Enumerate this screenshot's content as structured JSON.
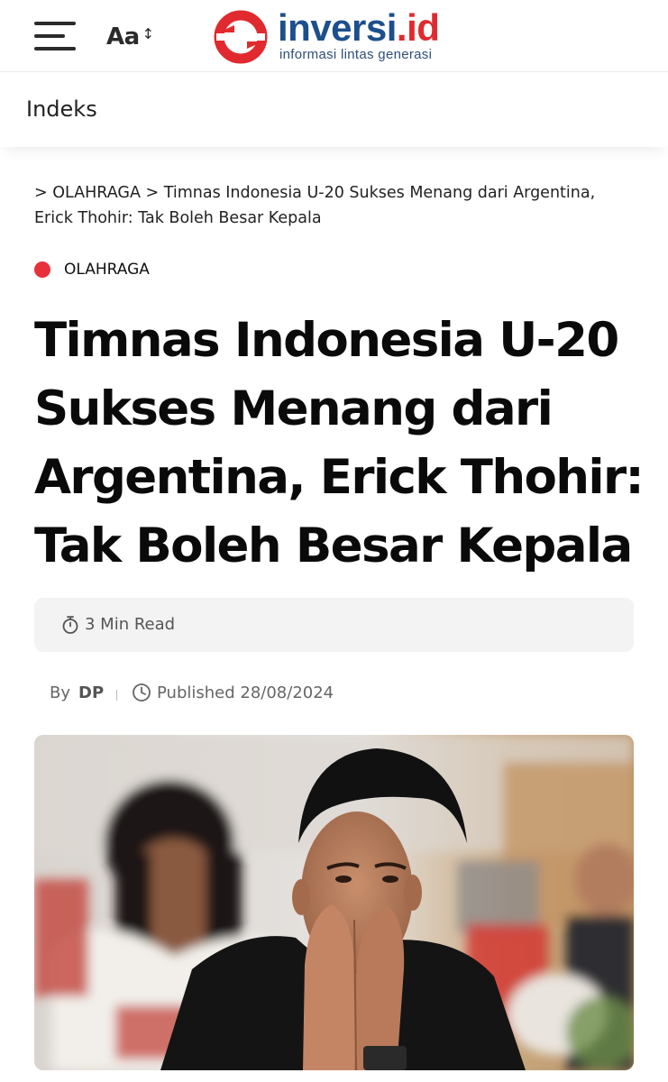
{
  "header": {
    "menu_icon": "hamburger-menu-icon",
    "font_size_label": "Aa",
    "font_size_icon": "up-down-arrow-icon",
    "logo": {
      "word_main": "inversi",
      "word_suffix": ".id",
      "tagline": "informasi lintas generasi",
      "brand_red": "#e02a2f",
      "brand_blue": "#1d4f8c"
    }
  },
  "index_bar": {
    "label": "Indeks"
  },
  "breadcrumb": {
    "text": "> OLAHRAGA > Timnas Indonesia U-20 Sukses Menang dari Argentina, Erick Thohir: Tak Boleh Besar Kepala"
  },
  "category": {
    "label": "OLAHRAGA",
    "color": "#e8303a"
  },
  "article": {
    "title": "Timnas Indonesia U-20 Sukses Menang dari Argentina, Erick Thohir: Tak Boleh Besar Kepala",
    "read_time": "3 Min Read",
    "by_label": "By",
    "author": "DP",
    "published": "Published 28/08/2024",
    "hero_image": "photo of a man in black shirt with hands clasped in front of his face"
  }
}
